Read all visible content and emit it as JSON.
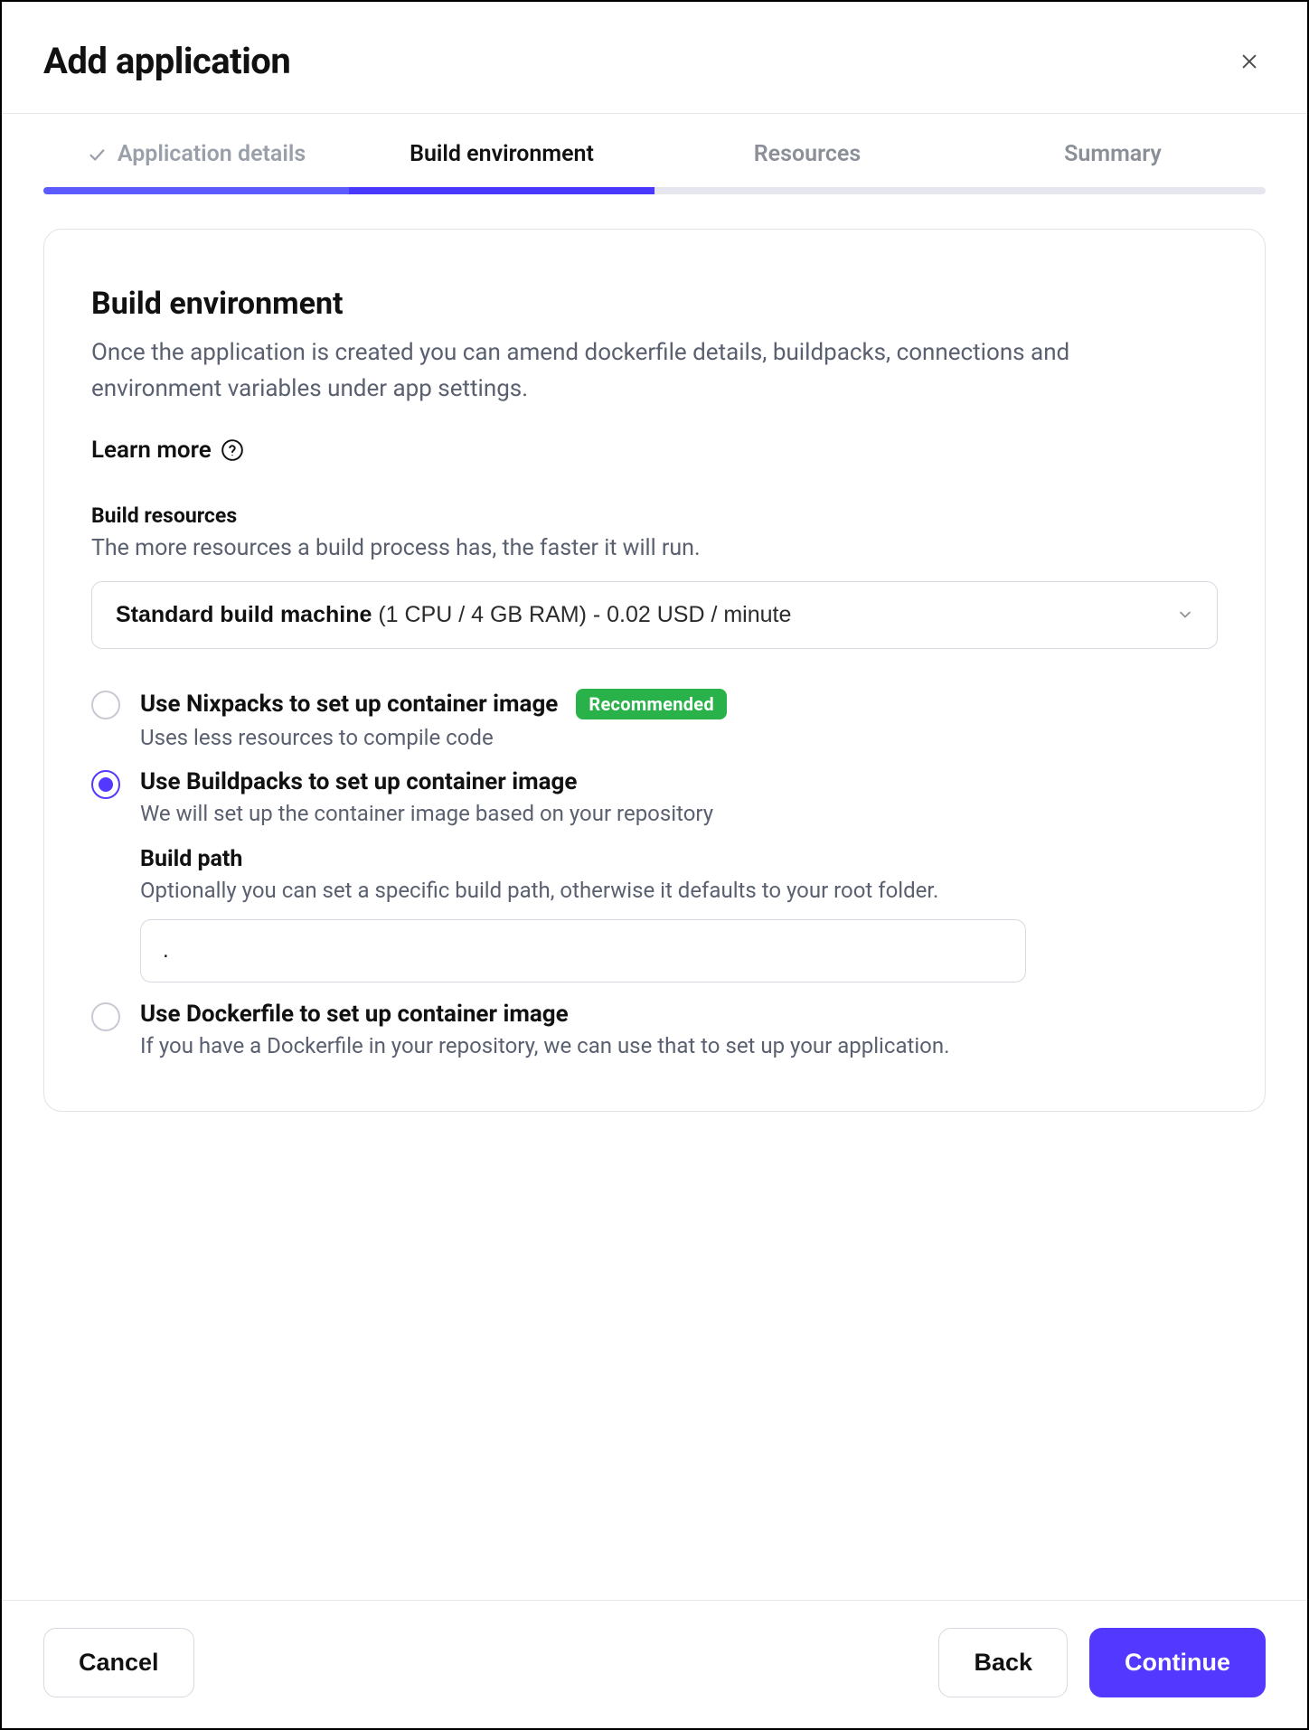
{
  "dialog": {
    "title": "Add application"
  },
  "steps": {
    "items": [
      {
        "label": "Application details",
        "state": "completed"
      },
      {
        "label": "Build environment",
        "state": "active"
      },
      {
        "label": "Resources",
        "state": "upcoming"
      },
      {
        "label": "Summary",
        "state": "upcoming"
      }
    ]
  },
  "section": {
    "title": "Build environment",
    "description": "Once the application is created you can amend dockerfile details, buildpacks, connections and environment variables under app settings.",
    "learn_more": "Learn more"
  },
  "build_resources": {
    "heading": "Build resources",
    "description": "The more resources a build process has, the faster it will run.",
    "selected_bold": "Standard build machine",
    "selected_rest": " (1 CPU / 4 GB RAM) - 0.02 USD / minute"
  },
  "options": {
    "nixpacks": {
      "title": "Use Nixpacks to set up container image",
      "badge": "Recommended",
      "desc": "Uses less resources to compile code",
      "selected": false
    },
    "buildpacks": {
      "title": "Use Buildpacks to set up container image",
      "desc": "We will set up the container image based on your repository",
      "selected": true,
      "build_path": {
        "title": "Build path",
        "desc": "Optionally you can set a specific build path, otherwise it defaults to your root folder.",
        "value": "."
      }
    },
    "dockerfile": {
      "title": "Use Dockerfile to set up container image",
      "desc": "If you have a Dockerfile in your repository, we can use that to set up your application.",
      "selected": false
    }
  },
  "footer": {
    "cancel": "Cancel",
    "back": "Back",
    "continue": "Continue"
  }
}
